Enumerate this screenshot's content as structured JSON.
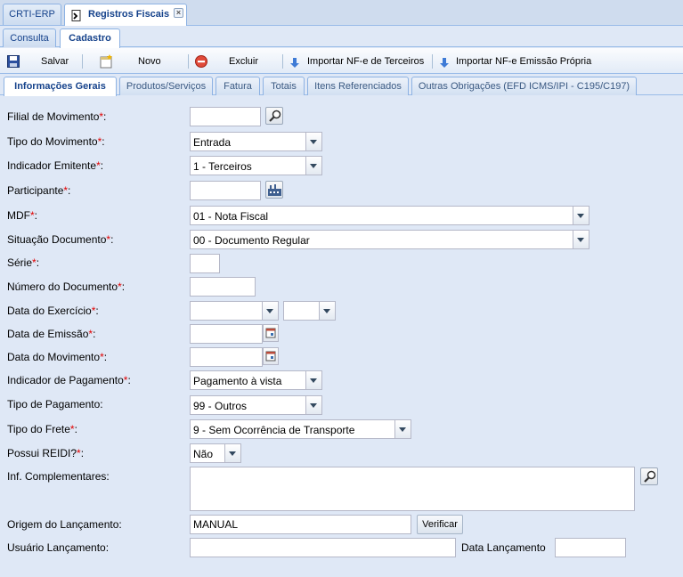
{
  "top_tabs": [
    {
      "label": "CRTI-ERP"
    },
    {
      "label": "Registros Fiscais"
    }
  ],
  "sub_tabs": [
    {
      "label": "Consulta"
    },
    {
      "label": "Cadastro"
    }
  ],
  "toolbar": {
    "save": "Salvar",
    "new": "Novo",
    "delete": "Excluir",
    "import_third": "Importar NF-e de Terceiros",
    "import_own": "Importar NF-e Emissão Própria"
  },
  "section_tabs": [
    {
      "label": "Informações Gerais"
    },
    {
      "label": "Produtos/Serviços"
    },
    {
      "label": "Fatura"
    },
    {
      "label": "Totais"
    },
    {
      "label": "Itens Referenciados"
    },
    {
      "label": "Outras Obrigações (EFD ICMS/IPI - C195/C197)"
    }
  ],
  "required_mark": "*",
  "form": {
    "filial": {
      "label": "Filial de Movimento",
      "suffix": ":",
      "value": ""
    },
    "tipo_movimento": {
      "label": "Tipo do Movimento",
      "suffix": ":",
      "value": "Entrada"
    },
    "indicador_emitente": {
      "label": "Indicador Emitente",
      "suffix": ":",
      "value": "1 - Terceiros"
    },
    "participante": {
      "label": "Participante",
      "suffix": ":",
      "value": ""
    },
    "mdf": {
      "label": "MDF",
      "suffix": ":",
      "value": "01 - Nota Fiscal"
    },
    "situacao": {
      "label": "Situação Documento",
      "suffix": ":",
      "value": "00 - Documento Regular"
    },
    "serie": {
      "label": "Série",
      "suffix": ":",
      "value": ""
    },
    "numero": {
      "label": "Número do Documento",
      "suffix": ":",
      "value": ""
    },
    "data_exercicio": {
      "label": "Data do Exercício",
      "suffix": ":",
      "value": ""
    },
    "data_emissao": {
      "label": "Data de Emissão",
      "suffix": ":",
      "value": ""
    },
    "data_movimento": {
      "label": "Data do Movimento",
      "suffix": ":",
      "value": ""
    },
    "indicador_pagamento": {
      "label": "Indicador de Pagamento",
      "suffix": ":",
      "value": "Pagamento à vista"
    },
    "tipo_pagamento": {
      "label": "Tipo de Pagamento:",
      "value": "99 - Outros"
    },
    "tipo_frete": {
      "label": "Tipo do Frete",
      "suffix": ":",
      "value": "9 - Sem Ocorrência de Transporte"
    },
    "possui_reidi": {
      "label": "Possui REIDI?",
      "suffix": ":",
      "value": "Não"
    },
    "inf_complementares": {
      "label": "Inf. Complementares:",
      "value": ""
    },
    "origem": {
      "label": "Origem do Lançamento:",
      "value": "MANUAL"
    },
    "verificar": "Verificar",
    "usuario": {
      "label": "Usuário Lançamento:",
      "value": ""
    },
    "data_lancamento": {
      "label": "Data Lançamento",
      "value": ""
    }
  },
  "colors": {
    "background": "#dfe8f6",
    "tab_text": "#15428b",
    "required": "#e00000",
    "border": "#99bbe8"
  }
}
